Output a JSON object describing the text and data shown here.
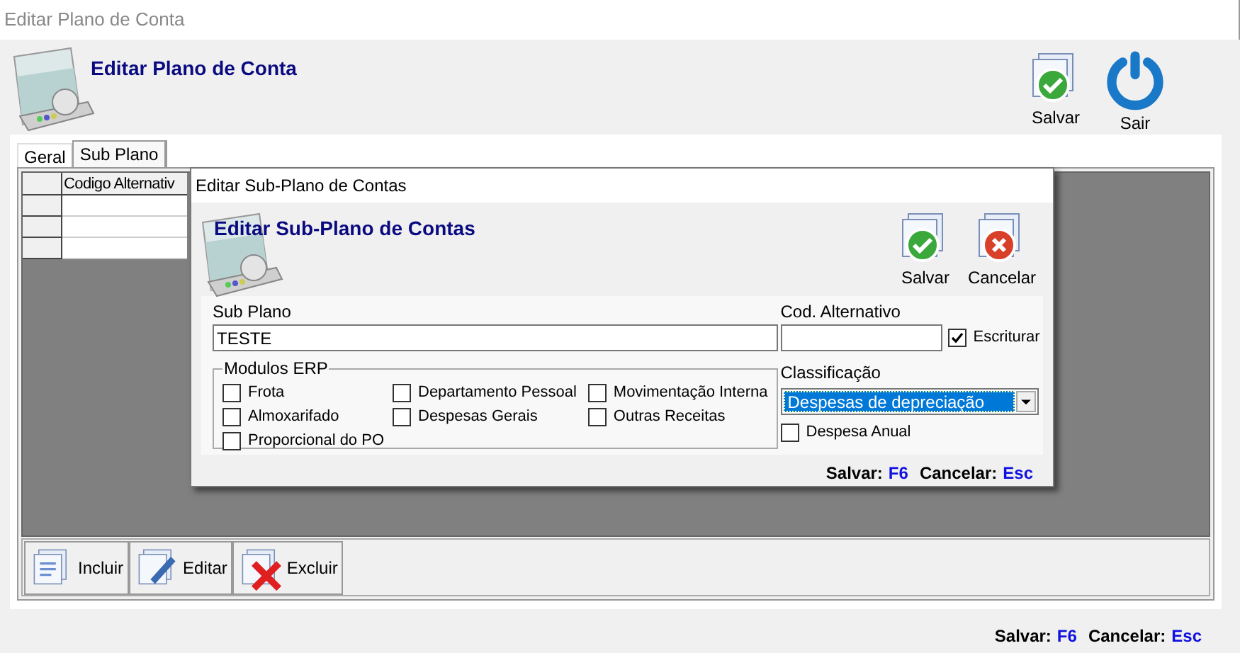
{
  "window": {
    "title": "Editar Plano de Conta",
    "heading": "Editar Plano de Conta"
  },
  "toolbar": [
    {
      "label": "Salvar",
      "kind": "save"
    },
    {
      "label": "Sair",
      "kind": "power"
    }
  ],
  "tabs": [
    {
      "label": "Geral",
      "selected": false
    },
    {
      "label": "Sub Plano",
      "selected": true
    }
  ],
  "grid": {
    "columns": [
      "Codigo Alternativ"
    ]
  },
  "actions": [
    {
      "label": "Incluir",
      "kind": "add"
    },
    {
      "label": "Editar",
      "kind": "edit"
    },
    {
      "label": "Excluir",
      "kind": "delete"
    }
  ],
  "status_bar": [
    {
      "label": "Salvar:",
      "key": "F6"
    },
    {
      "label": "Cancelar:",
      "key": "Esc"
    }
  ],
  "dialog": {
    "title": "Editar Sub-Plano de Contas",
    "heading": "Editar Sub-Plano de Contas",
    "toolbar": [
      {
        "label": "Salvar",
        "kind": "save"
      },
      {
        "label": "Cancelar",
        "kind": "cancel"
      }
    ],
    "sub_plano": {
      "label": "Sub Plano",
      "value": "TESTE"
    },
    "cod_alternativo": {
      "label": "Cod. Alternativo"
    },
    "escriturar": {
      "label": "Escriturar",
      "checked": true
    },
    "modulos": {
      "title": "Modulos ERP",
      "columns": [
        [
          {
            "label": "Frota",
            "checked": false
          },
          {
            "label": "Almoxarifado",
            "checked": false
          },
          {
            "label": "Proporcional do PO",
            "checked": false
          }
        ],
        [
          {
            "label": "Departamento Pessoal",
            "checked": false
          },
          {
            "label": "Despesas Gerais",
            "checked": false
          }
        ],
        [
          {
            "label": "Movimentação Interna",
            "checked": false
          },
          {
            "label": "Outras Receitas",
            "checked": false
          }
        ]
      ]
    },
    "classificacao": {
      "label": "Classificação",
      "value": "Despesas de depreciação"
    },
    "despesa_anual": {
      "label": "Despesa Anual",
      "checked": false
    },
    "status_bar": [
      {
        "label": "Salvar:",
        "key": "F6"
      },
      {
        "label": "Cancelar:",
        "key": "Esc"
      }
    ]
  }
}
